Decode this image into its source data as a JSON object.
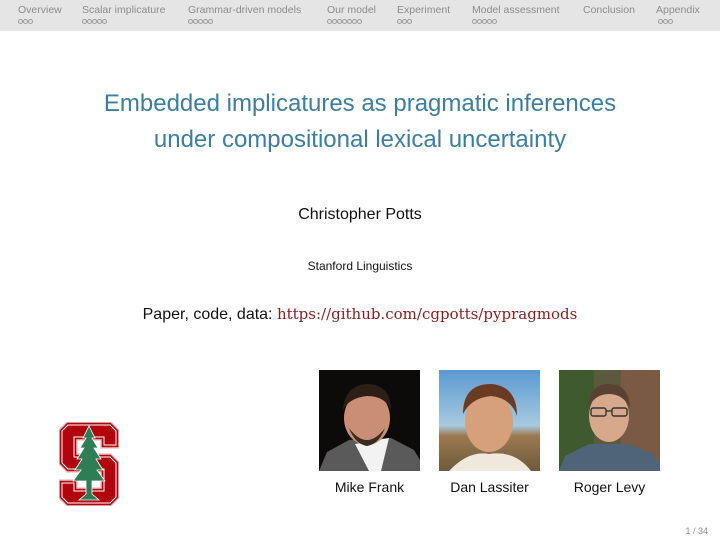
{
  "nav": {
    "sections": [
      {
        "label": "Overview",
        "dots": 3
      },
      {
        "label": "Scalar implicature",
        "dots": 5
      },
      {
        "label": "Grammar-driven models",
        "dots": 5
      },
      {
        "label": "Our model",
        "dots": 7
      },
      {
        "label": "Experiment",
        "dots": 3
      },
      {
        "label": "Model assessment",
        "dots": 5
      },
      {
        "label": "Conclusion",
        "dots": 0
      },
      {
        "label": "Appendix",
        "dots": 3
      }
    ]
  },
  "slide": {
    "title_line1": "Embedded implicatures as pragmatic inferences",
    "title_line2": "under compositional lexical uncertainty",
    "author": "Christopher Potts",
    "institution": "Stanford Linguistics",
    "links_label": "Paper, code, data: ",
    "links_url": "https://github.com/cgpotts/pypragmods",
    "logo": "stanford-logo",
    "collaborators": [
      {
        "name": "Mike Frank",
        "photo": "photo-mike-frank"
      },
      {
        "name": "Dan Lassiter",
        "photo": "photo-dan-lassiter"
      },
      {
        "name": "Roger Levy",
        "photo": "photo-roger-levy"
      }
    ],
    "page_number": "1 / 34"
  },
  "colors": {
    "title": "#3b7ea1",
    "url": "#8b1c1c",
    "nav_bg": "#e5e5e5",
    "stanford_red": "#b1040e",
    "stanford_green": "#2e7d54"
  }
}
